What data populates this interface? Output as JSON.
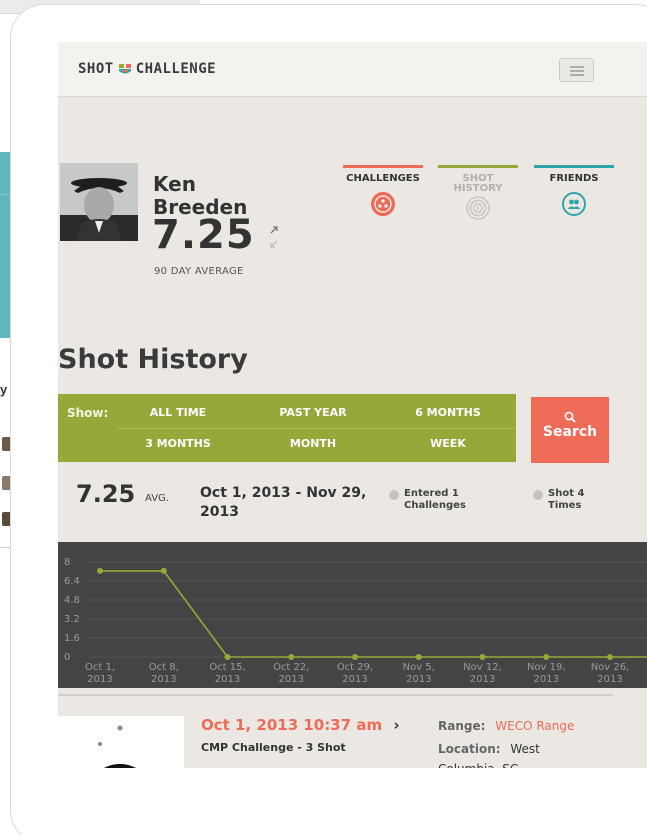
{
  "app": {
    "logo_left": "SHOT",
    "logo_right": "CHALLENGE"
  },
  "profile": {
    "first_name": "Ken",
    "last_name": "Breeden",
    "score": "7.25",
    "score_caption": "90 DAY AVERAGE"
  },
  "tabs": [
    {
      "label": "CHALLENGES",
      "color": "#ee6b58",
      "icon": "target-icon"
    },
    {
      "label": "SHOT HISTORY",
      "color": "#97a83a",
      "icon": "rings-icon"
    },
    {
      "label": "FRIENDS",
      "color": "#2ea5a8",
      "icon": "friends-icon"
    }
  ],
  "page": {
    "title": "Shot History"
  },
  "filter": {
    "show_label": "Show:",
    "options_row1": [
      "ALL TIME",
      "PAST YEAR",
      "6 MONTHS"
    ],
    "options_row2": [
      "3 MONTHS",
      "MONTH",
      "WEEK"
    ],
    "search_label": "Search"
  },
  "summary": {
    "average": "7.25",
    "average_label": "AVG.",
    "date_range": "Oct 1, 2013 - Nov 29, 2013",
    "stat_challenges": "Entered 1 Challenges",
    "stat_shots": "Shot 4 Times"
  },
  "chart_data": {
    "type": "line",
    "x": [
      "Oct 1, 2013",
      "Oct 8, 2013",
      "Oct 15, 2013",
      "Oct 22, 2013",
      "Oct 29, 2013",
      "Nov 5, 2013",
      "Nov 12, 2013",
      "Nov 19, 2013",
      "Nov 26, 2013"
    ],
    "series": [
      {
        "values": [
          7.25,
          7.25,
          0,
          0,
          0,
          0,
          0,
          0,
          0,
          0
        ]
      }
    ],
    "y_ticks": [
      0,
      1.6,
      3.2,
      4.8,
      6.4,
      8
    ],
    "ylim": [
      0,
      8
    ],
    "grid": true,
    "line_color": "#97a83a"
  },
  "entry": {
    "date": "Oct 1, 2013 10:37 am",
    "chevron": "›",
    "title": "CMP Challenge - 3 Shot",
    "range_label": "Range:",
    "range_value": "WECO Range",
    "location_label": "Location:",
    "location_value": "West Columbia, SC"
  }
}
